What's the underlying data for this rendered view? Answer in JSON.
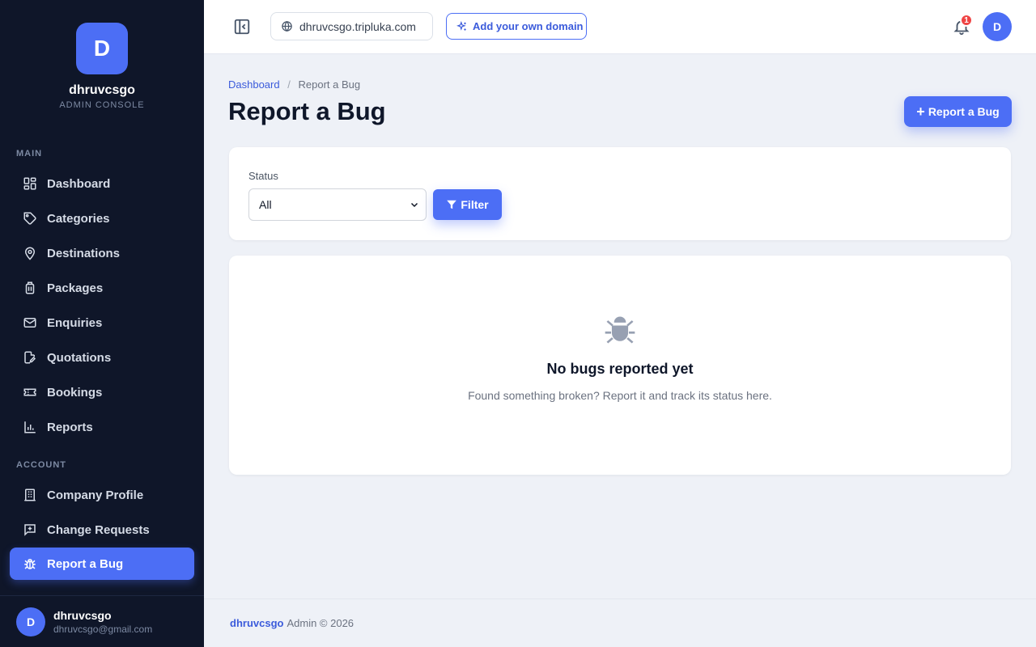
{
  "brand": {
    "initial": "D",
    "name": "dhruvcsgo",
    "subtitle": "ADMIN CONSOLE"
  },
  "sidebar": {
    "main_label": "MAIN",
    "main_items": [
      {
        "label": "Dashboard",
        "icon": "dashboard-icon"
      },
      {
        "label": "Categories",
        "icon": "tag-icon"
      },
      {
        "label": "Destinations",
        "icon": "map-pin-icon"
      },
      {
        "label": "Packages",
        "icon": "luggage-icon"
      },
      {
        "label": "Enquiries",
        "icon": "mail-icon"
      },
      {
        "label": "Quotations",
        "icon": "file-edit-icon"
      },
      {
        "label": "Bookings",
        "icon": "ticket-icon"
      },
      {
        "label": "Reports",
        "icon": "bar-chart-icon"
      }
    ],
    "account_label": "ACCOUNT",
    "account_items": [
      {
        "label": "Company Profile",
        "icon": "building-icon"
      },
      {
        "label": "Change Requests",
        "icon": "message-plus-icon"
      },
      {
        "label": "Report a Bug",
        "icon": "bug-icon",
        "active": true
      }
    ],
    "user": {
      "initial": "D",
      "name": "dhruvcsgo",
      "email": "dhruvcsgo@gmail.com"
    }
  },
  "topbar": {
    "domain": "dhruvcsgo.tripluka.com",
    "add_domain_label": "Add your own domain",
    "notification_count": "1",
    "avatar_initial": "D"
  },
  "breadcrumb": {
    "root": "Dashboard",
    "separator": "/",
    "current": "Report a Bug"
  },
  "page_title": "Report a Bug",
  "primary_button": {
    "icon": "+",
    "label": "Report a Bug"
  },
  "filter": {
    "label": "Status",
    "selected": "All",
    "button_label": "Filter"
  },
  "empty_state": {
    "title": "No bugs reported yet",
    "subtitle": "Found something broken? Report it and track its status here."
  },
  "footer": {
    "brand": "dhruvcsgo",
    "text": "Admin © 2026"
  },
  "colors": {
    "accent": "#4c6ef5",
    "sidebar_bg": "#0f1629",
    "page_bg": "#eef1f7",
    "badge": "#ef4444"
  }
}
